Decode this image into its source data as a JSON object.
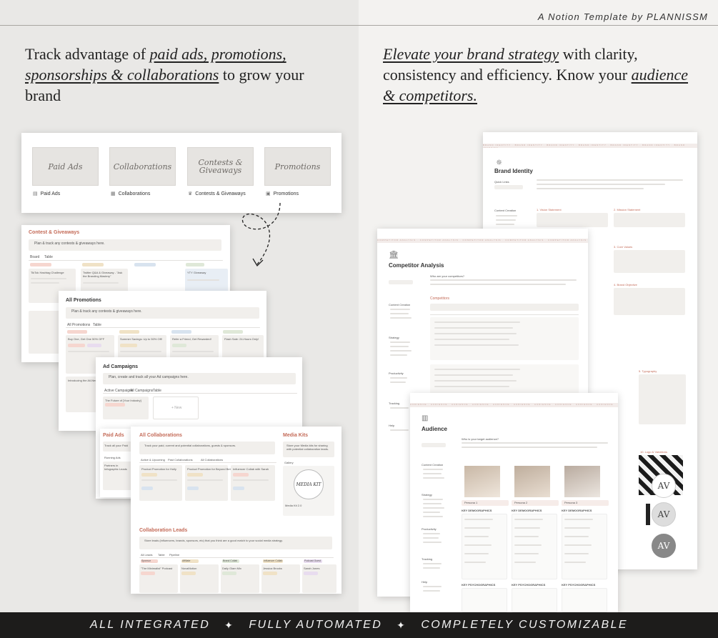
{
  "header": {
    "credit": "A Notion Template by PLANNISSM"
  },
  "left_headline": {
    "part1": "Track advantage of ",
    "emph1": "paid ads, promotions, sponsorships & collaborations",
    "part2": " to grow your brand"
  },
  "right_headline": {
    "emph1": "Elevate your brand strategy",
    "part1": " with clarity, consistency and efficiency. Know your ",
    "emph2": "audience & competitors."
  },
  "gallery": {
    "tiles": [
      {
        "script": "Paid Ads",
        "label": "Paid Ads",
        "icon": "document-icon"
      },
      {
        "script": "Collaborations",
        "label": "Collaborations",
        "icon": "grid-icon"
      },
      {
        "script": "Contests & Giveaways",
        "label": "Contests & Giveaways",
        "icon": "trophy-icon"
      },
      {
        "script": "Promotions",
        "label": "Promotions",
        "icon": "bag-icon"
      }
    ]
  },
  "contests": {
    "title": "Contest & Giveaways",
    "callout": "Plan & track any contests & giveaways here.",
    "tabs": [
      "Board",
      "Table"
    ],
    "columns": [
      "Not started",
      "Planned",
      "In progress",
      "Done"
    ],
    "items": [
      "TikTok Hashtag Challenge",
      "Twitter Q&A & Giveaway - \"Ask the Branding Mastery\"",
      "YTY Giveaway"
    ]
  },
  "promotions": {
    "title": "All Promotions",
    "callout": "Plan & track any contests & giveaways here.",
    "tabs": [
      "All Promotions",
      "Table"
    ],
    "columns": [
      "Not started",
      "Planning",
      "In progress",
      "Completed"
    ],
    "items": [
      "Buy One, Get One 50% OFF",
      "Summer Savings: Up to 50% Off!",
      "Refer a Friend, Get Rewarded!",
      "Flash Sale: 24-Hours Only!",
      "Introducing the All-New"
    ]
  },
  "ads": {
    "title": "Ad Campaigns",
    "callout": "Plan, create and track all your Ad campaigns here.",
    "tabs": [
      "Active Campaigns",
      "All Campaigns",
      "Table"
    ],
    "item": "The Future of [Your Industry]",
    "new": "+ New"
  },
  "paid_ads": {
    "title": "Paid Ads",
    "callout": "Track all your Paid",
    "tab": "Running Ads",
    "item": "Partners in Infographic Leads"
  },
  "collabs": {
    "title": "All Collaborations",
    "callout": "Track your paid, current and potential collaborations, guests & sponsors.",
    "tabs": [
      "Active & Upcoming",
      "Past Collaborations",
      "All Collaborations"
    ],
    "items": [
      "Product Promotion for Holly",
      "Product Promotion for Beyond Beta",
      "Influencer Collab with Sarah"
    ]
  },
  "media_kits": {
    "title": "Media Kits",
    "callout": "Store your Media kits for sharing with potential collaboration leads.",
    "tab": "Gallery",
    "kit_text": "MEDIA KIT",
    "item": "Media Kit 2.0"
  },
  "leads": {
    "title": "Collaboration Leads",
    "callout": "Store leads (influencers, brands, sponsors, etc) that you think are a good match to your social media strategy.",
    "tabs": [
      "All Leads",
      "Table",
      "Pipeline"
    ],
    "columns": [
      "Sponsor",
      "Affiliate",
      "Brand Collab",
      "Influencer Collab",
      "Podcast Guest"
    ],
    "items": [
      "\"The Minimalist\" Podcast",
      "NovaMotion",
      "Daily Glam Mix",
      "Jessica Brooks",
      "Sarah Jones"
    ]
  },
  "brand_identity": {
    "title": "Brand Identity",
    "sections": [
      "1. Vision Statement",
      "2. Mission Statement",
      "3. Core Values",
      "4. Brand Objective",
      "5. Typography",
      "10. Logo & Variations"
    ],
    "quick_links": "Quick Links",
    "content_creation": "Content Creation",
    "strip": "BRAND IDENTITY · BRAND IDENTITY · BRAND IDENTITY · BRAND IDENTITY · BRAND IDENTITY · BRAND IDENTITY · BRAND IDENTITY"
  },
  "competitor": {
    "title": "Competitor Analysis",
    "heading": "Competitors",
    "sub": "Who are your competitors?",
    "sidebar": [
      "Content Creation",
      "Strategy",
      "Productivity",
      "Tracking",
      "Help"
    ],
    "strip": "COMPETITOR ANALYSIS · COMPETITOR ANALYSIS · COMPETITOR ANALYSIS · COMPETITOR ANALYSIS · COMPETITOR ANALYSIS"
  },
  "audience": {
    "title": "Audience",
    "sub": "Who is your target audience?",
    "personas": [
      "Persona 1",
      "Persona 2",
      "Persona 3"
    ],
    "key_demo": "KEY DEMOGRAPHICS",
    "key_psycho": "KEY PSYCHOGRAPHICS",
    "sidebar": [
      "Content Creation",
      "Strategy",
      "Productivity",
      "Tracking",
      "Help"
    ],
    "strip": "AUDIENCE · AUDIENCE · AUDIENCE · AUDIENCE · AUDIENCE · AUDIENCE · AUDIENCE · AUDIENCE · AUDIENCE · AUDIENCE"
  },
  "footer": {
    "items": [
      "ALL INTEGRATED",
      "FULLY AUTOMATED",
      "COMPLETELY CUSTOMIZABLE"
    ],
    "separator": "✦"
  }
}
